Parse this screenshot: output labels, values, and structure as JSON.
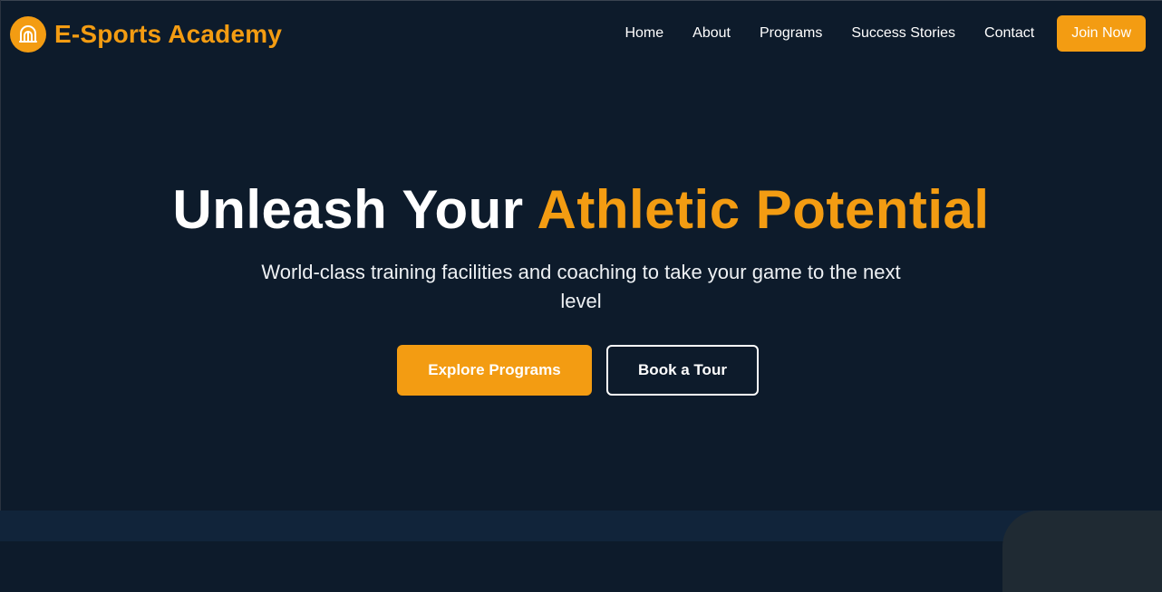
{
  "brand": {
    "name": "E-Sports Academy",
    "logo_icon": "stadium-arch-icon",
    "accent_color": "#f39c12"
  },
  "nav": {
    "links": [
      "Home",
      "About",
      "Programs",
      "Success Stories",
      "Contact"
    ],
    "cta_label": "Join Now"
  },
  "hero": {
    "title_main": "Unleash Your ",
    "title_accent": "Athletic Potential",
    "subtitle": "World-class training facilities and coaching to take your game to the next level",
    "primary_button": "Explore Programs",
    "secondary_button": "Book a Tour"
  },
  "colors": {
    "background": "#0d1b2b",
    "accent": "#f39c12",
    "text": "#ffffff"
  }
}
